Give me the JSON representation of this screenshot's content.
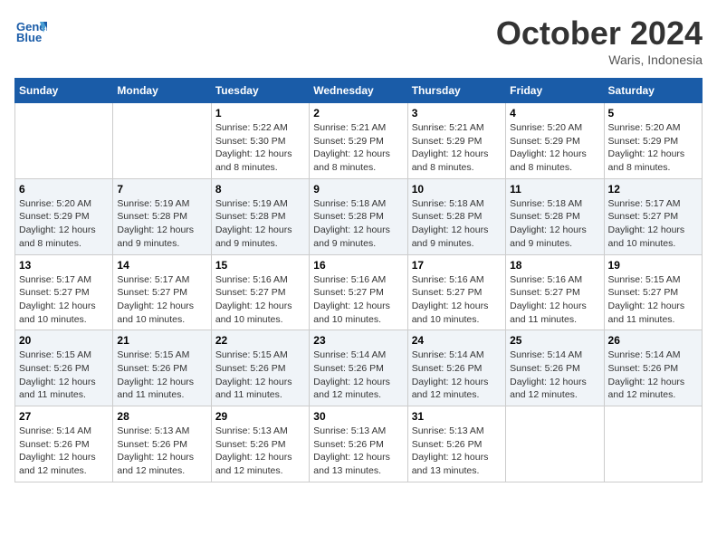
{
  "header": {
    "logo_line1": "General",
    "logo_line2": "Blue",
    "month": "October 2024",
    "location": "Waris, Indonesia"
  },
  "weekdays": [
    "Sunday",
    "Monday",
    "Tuesday",
    "Wednesday",
    "Thursday",
    "Friday",
    "Saturday"
  ],
  "weeks": [
    [
      {
        "day": null,
        "info": null
      },
      {
        "day": null,
        "info": null
      },
      {
        "day": "1",
        "info": "Sunrise: 5:22 AM\nSunset: 5:30 PM\nDaylight: 12 hours and 8 minutes."
      },
      {
        "day": "2",
        "info": "Sunrise: 5:21 AM\nSunset: 5:29 PM\nDaylight: 12 hours and 8 minutes."
      },
      {
        "day": "3",
        "info": "Sunrise: 5:21 AM\nSunset: 5:29 PM\nDaylight: 12 hours and 8 minutes."
      },
      {
        "day": "4",
        "info": "Sunrise: 5:20 AM\nSunset: 5:29 PM\nDaylight: 12 hours and 8 minutes."
      },
      {
        "day": "5",
        "info": "Sunrise: 5:20 AM\nSunset: 5:29 PM\nDaylight: 12 hours and 8 minutes."
      }
    ],
    [
      {
        "day": "6",
        "info": "Sunrise: 5:20 AM\nSunset: 5:29 PM\nDaylight: 12 hours and 8 minutes."
      },
      {
        "day": "7",
        "info": "Sunrise: 5:19 AM\nSunset: 5:28 PM\nDaylight: 12 hours and 9 minutes."
      },
      {
        "day": "8",
        "info": "Sunrise: 5:19 AM\nSunset: 5:28 PM\nDaylight: 12 hours and 9 minutes."
      },
      {
        "day": "9",
        "info": "Sunrise: 5:18 AM\nSunset: 5:28 PM\nDaylight: 12 hours and 9 minutes."
      },
      {
        "day": "10",
        "info": "Sunrise: 5:18 AM\nSunset: 5:28 PM\nDaylight: 12 hours and 9 minutes."
      },
      {
        "day": "11",
        "info": "Sunrise: 5:18 AM\nSunset: 5:28 PM\nDaylight: 12 hours and 9 minutes."
      },
      {
        "day": "12",
        "info": "Sunrise: 5:17 AM\nSunset: 5:27 PM\nDaylight: 12 hours and 10 minutes."
      }
    ],
    [
      {
        "day": "13",
        "info": "Sunrise: 5:17 AM\nSunset: 5:27 PM\nDaylight: 12 hours and 10 minutes."
      },
      {
        "day": "14",
        "info": "Sunrise: 5:17 AM\nSunset: 5:27 PM\nDaylight: 12 hours and 10 minutes."
      },
      {
        "day": "15",
        "info": "Sunrise: 5:16 AM\nSunset: 5:27 PM\nDaylight: 12 hours and 10 minutes."
      },
      {
        "day": "16",
        "info": "Sunrise: 5:16 AM\nSunset: 5:27 PM\nDaylight: 12 hours and 10 minutes."
      },
      {
        "day": "17",
        "info": "Sunrise: 5:16 AM\nSunset: 5:27 PM\nDaylight: 12 hours and 10 minutes."
      },
      {
        "day": "18",
        "info": "Sunrise: 5:16 AM\nSunset: 5:27 PM\nDaylight: 12 hours and 11 minutes."
      },
      {
        "day": "19",
        "info": "Sunrise: 5:15 AM\nSunset: 5:27 PM\nDaylight: 12 hours and 11 minutes."
      }
    ],
    [
      {
        "day": "20",
        "info": "Sunrise: 5:15 AM\nSunset: 5:26 PM\nDaylight: 12 hours and 11 minutes."
      },
      {
        "day": "21",
        "info": "Sunrise: 5:15 AM\nSunset: 5:26 PM\nDaylight: 12 hours and 11 minutes."
      },
      {
        "day": "22",
        "info": "Sunrise: 5:15 AM\nSunset: 5:26 PM\nDaylight: 12 hours and 11 minutes."
      },
      {
        "day": "23",
        "info": "Sunrise: 5:14 AM\nSunset: 5:26 PM\nDaylight: 12 hours and 12 minutes."
      },
      {
        "day": "24",
        "info": "Sunrise: 5:14 AM\nSunset: 5:26 PM\nDaylight: 12 hours and 12 minutes."
      },
      {
        "day": "25",
        "info": "Sunrise: 5:14 AM\nSunset: 5:26 PM\nDaylight: 12 hours and 12 minutes."
      },
      {
        "day": "26",
        "info": "Sunrise: 5:14 AM\nSunset: 5:26 PM\nDaylight: 12 hours and 12 minutes."
      }
    ],
    [
      {
        "day": "27",
        "info": "Sunrise: 5:14 AM\nSunset: 5:26 PM\nDaylight: 12 hours and 12 minutes."
      },
      {
        "day": "28",
        "info": "Sunrise: 5:13 AM\nSunset: 5:26 PM\nDaylight: 12 hours and 12 minutes."
      },
      {
        "day": "29",
        "info": "Sunrise: 5:13 AM\nSunset: 5:26 PM\nDaylight: 12 hours and 12 minutes."
      },
      {
        "day": "30",
        "info": "Sunrise: 5:13 AM\nSunset: 5:26 PM\nDaylight: 12 hours and 13 minutes."
      },
      {
        "day": "31",
        "info": "Sunrise: 5:13 AM\nSunset: 5:26 PM\nDaylight: 12 hours and 13 minutes."
      },
      {
        "day": null,
        "info": null
      },
      {
        "day": null,
        "info": null
      }
    ]
  ]
}
